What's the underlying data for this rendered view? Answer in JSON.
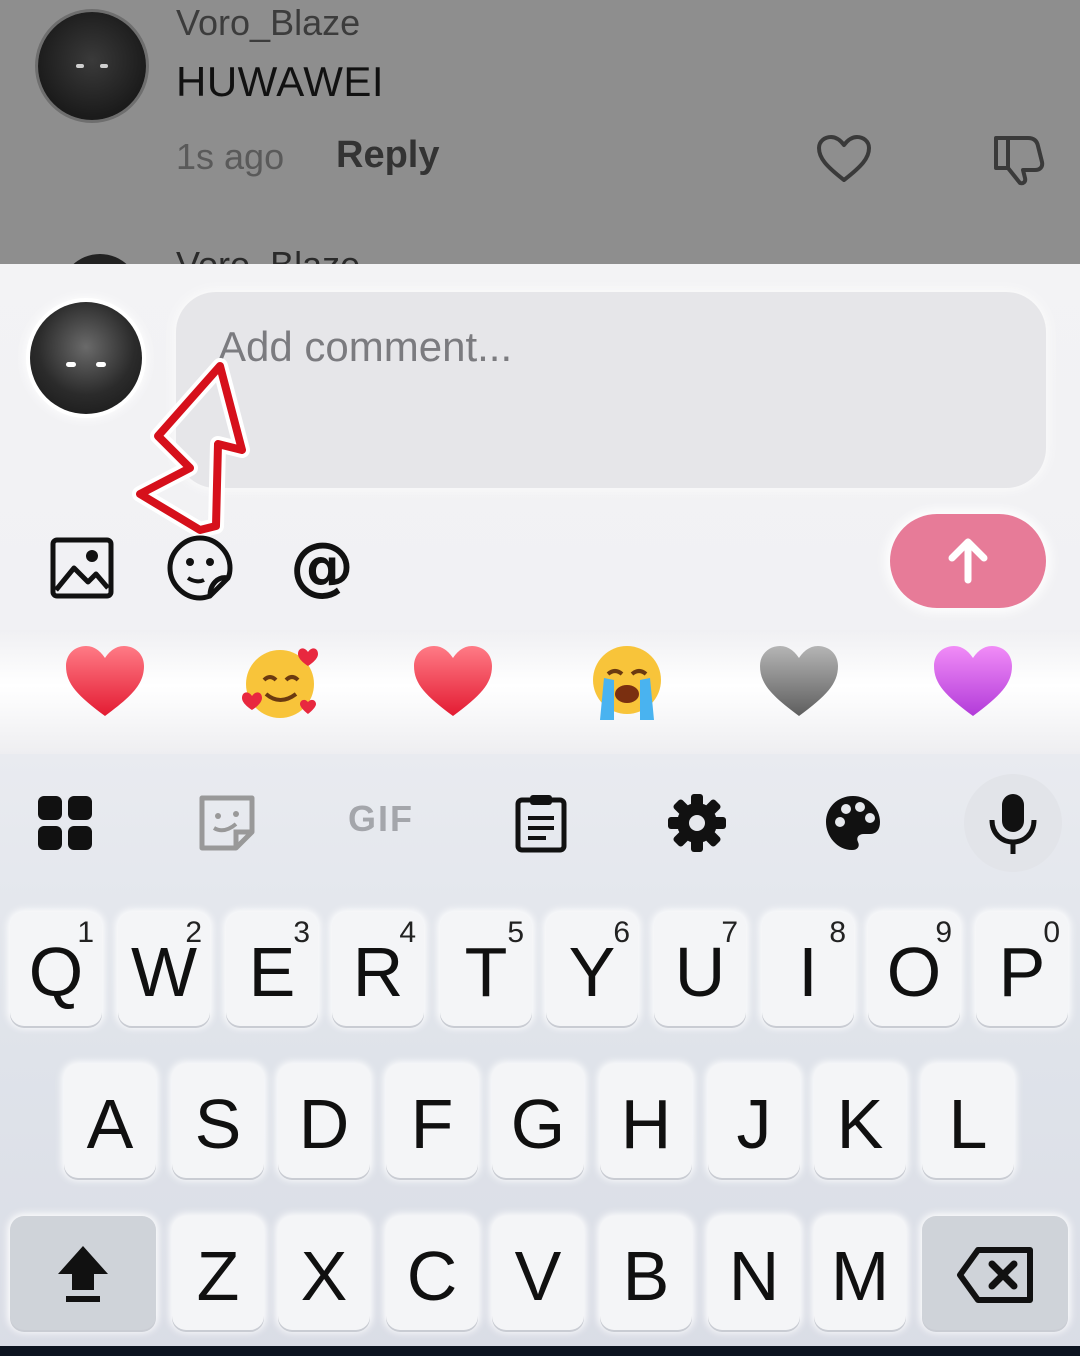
{
  "comment": {
    "username": "Voro_Blaze",
    "text": "HUWAWEI",
    "time": "1s ago",
    "reply_label": "Reply",
    "next_username": "Voro_Blaze"
  },
  "composer": {
    "placeholder": "Add comment..."
  },
  "emojis": [
    "heart-red",
    "smiling-face-with-hearts",
    "heart-red",
    "loudly-crying-face",
    "heart-grey",
    "heart-purple"
  ],
  "keyboard": {
    "toolbar_gif": "GIF",
    "row1": [
      {
        "ch": "Q",
        "sup": "1"
      },
      {
        "ch": "W",
        "sup": "2"
      },
      {
        "ch": "E",
        "sup": "3"
      },
      {
        "ch": "R",
        "sup": "4"
      },
      {
        "ch": "T",
        "sup": "5"
      },
      {
        "ch": "Y",
        "sup": "6"
      },
      {
        "ch": "U",
        "sup": "7"
      },
      {
        "ch": "I",
        "sup": "8"
      },
      {
        "ch": "O",
        "sup": "9"
      },
      {
        "ch": "P",
        "sup": "0"
      }
    ],
    "row2": [
      "A",
      "S",
      "D",
      "F",
      "G",
      "H",
      "J",
      "K",
      "L"
    ],
    "row3": [
      "Z",
      "X",
      "C",
      "V",
      "B",
      "N",
      "M"
    ]
  },
  "colors": {
    "send_button": "#e77b98",
    "annotation_arrow": "#d6101b"
  }
}
